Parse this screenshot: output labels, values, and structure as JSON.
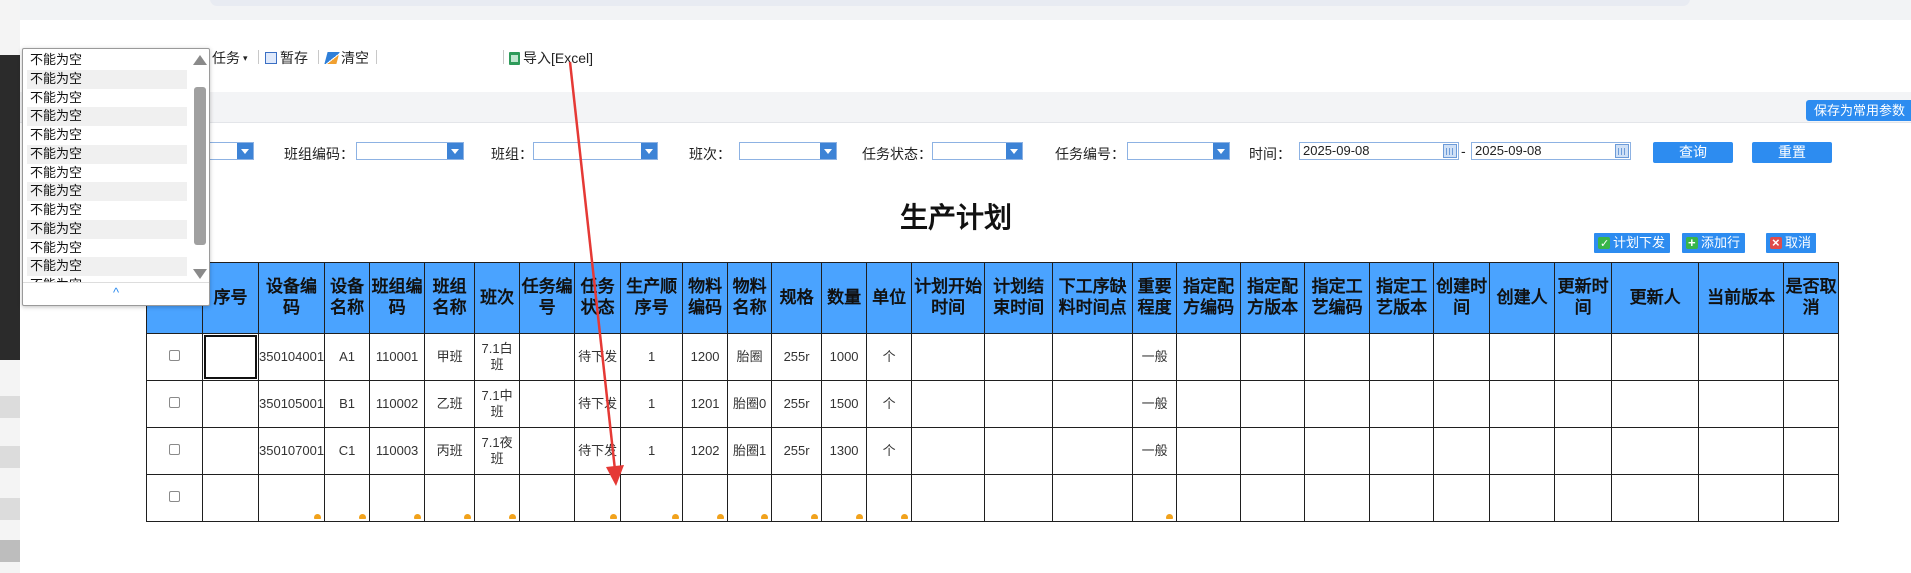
{
  "toolbar": {
    "task_label": "任务",
    "save_label": "暂存",
    "clear_label": "清空",
    "import_label": "导入[Excel]"
  },
  "save_common_params_label": "保存为常用参数",
  "filters": {
    "team_code_label": "班组编码：",
    "team_label": "班组：",
    "shift_label": "班次：",
    "task_status_label": "任务状态：",
    "task_no_label": "任务编号：",
    "time_label": "时间：",
    "date_from": "2025-09-08",
    "date_sep": "-",
    "date_to": "2025-09-08",
    "query_label": "查询",
    "reset_label": "重置"
  },
  "page_title": "生产计划",
  "grid_actions": {
    "dispatch_label": "计划下发",
    "add_row_label": "添加行",
    "cancel_label": "取消"
  },
  "columns": [
    "序号",
    "设备编码",
    "设备名称",
    "班组编码",
    "班组名称",
    "班次",
    "任务编号",
    "任务状态",
    "生产顺序号",
    "物料编码",
    "物料名称",
    "规格",
    "数量",
    "单位",
    "计划开始时间",
    "计划结束时间",
    "下工序缺料时间点",
    "重要程度",
    "指定配方编码",
    "指定配方版本",
    "指定工艺编码",
    "指定工艺版本",
    "创建时间",
    "创建人",
    "更新时间",
    "更新人",
    "当前版本",
    "是否取消"
  ],
  "rows": [
    [
      "",
      "350104001",
      "A1",
      "110001",
      "甲班",
      "7.1白班",
      "",
      "待下发",
      "1",
      "1200",
      "胎圈",
      "255r",
      "1000",
      "个",
      "",
      "",
      "",
      "一般",
      "",
      "",
      "",
      "",
      "",
      "",
      "",
      "",
      "",
      ""
    ],
    [
      "",
      "350105001",
      "B1",
      "110002",
      "乙班",
      "7.1中班",
      "",
      "待下发",
      "1",
      "1201",
      "胎圈0",
      "255r",
      "1500",
      "个",
      "",
      "",
      "",
      "一般",
      "",
      "",
      "",
      "",
      "",
      "",
      "",
      "",
      "",
      ""
    ],
    [
      "",
      "350107001",
      "C1",
      "110003",
      "丙班",
      "7.1夜班",
      "",
      "待下发",
      "1",
      "1202",
      "胎圈1",
      "255r",
      "1300",
      "个",
      "",
      "",
      "",
      "一般",
      "",
      "",
      "",
      "",
      "",
      "",
      "",
      "",
      "",
      ""
    ]
  ],
  "popup": {
    "items": [
      "不能为空",
      "不能为空",
      "不能为空",
      "不能为空",
      "不能为空",
      "不能为空",
      "不能为空",
      "不能为空",
      "不能为空",
      "不能为空",
      "不能为空",
      "不能为空",
      "不能为空"
    ],
    "collapse_glyph": "^"
  },
  "colors": {
    "header_blue": "#4aa3ff",
    "button_blue": "#2d8cf0",
    "annotation_red": "#e53935",
    "required_marker": "#f1a21c"
  }
}
